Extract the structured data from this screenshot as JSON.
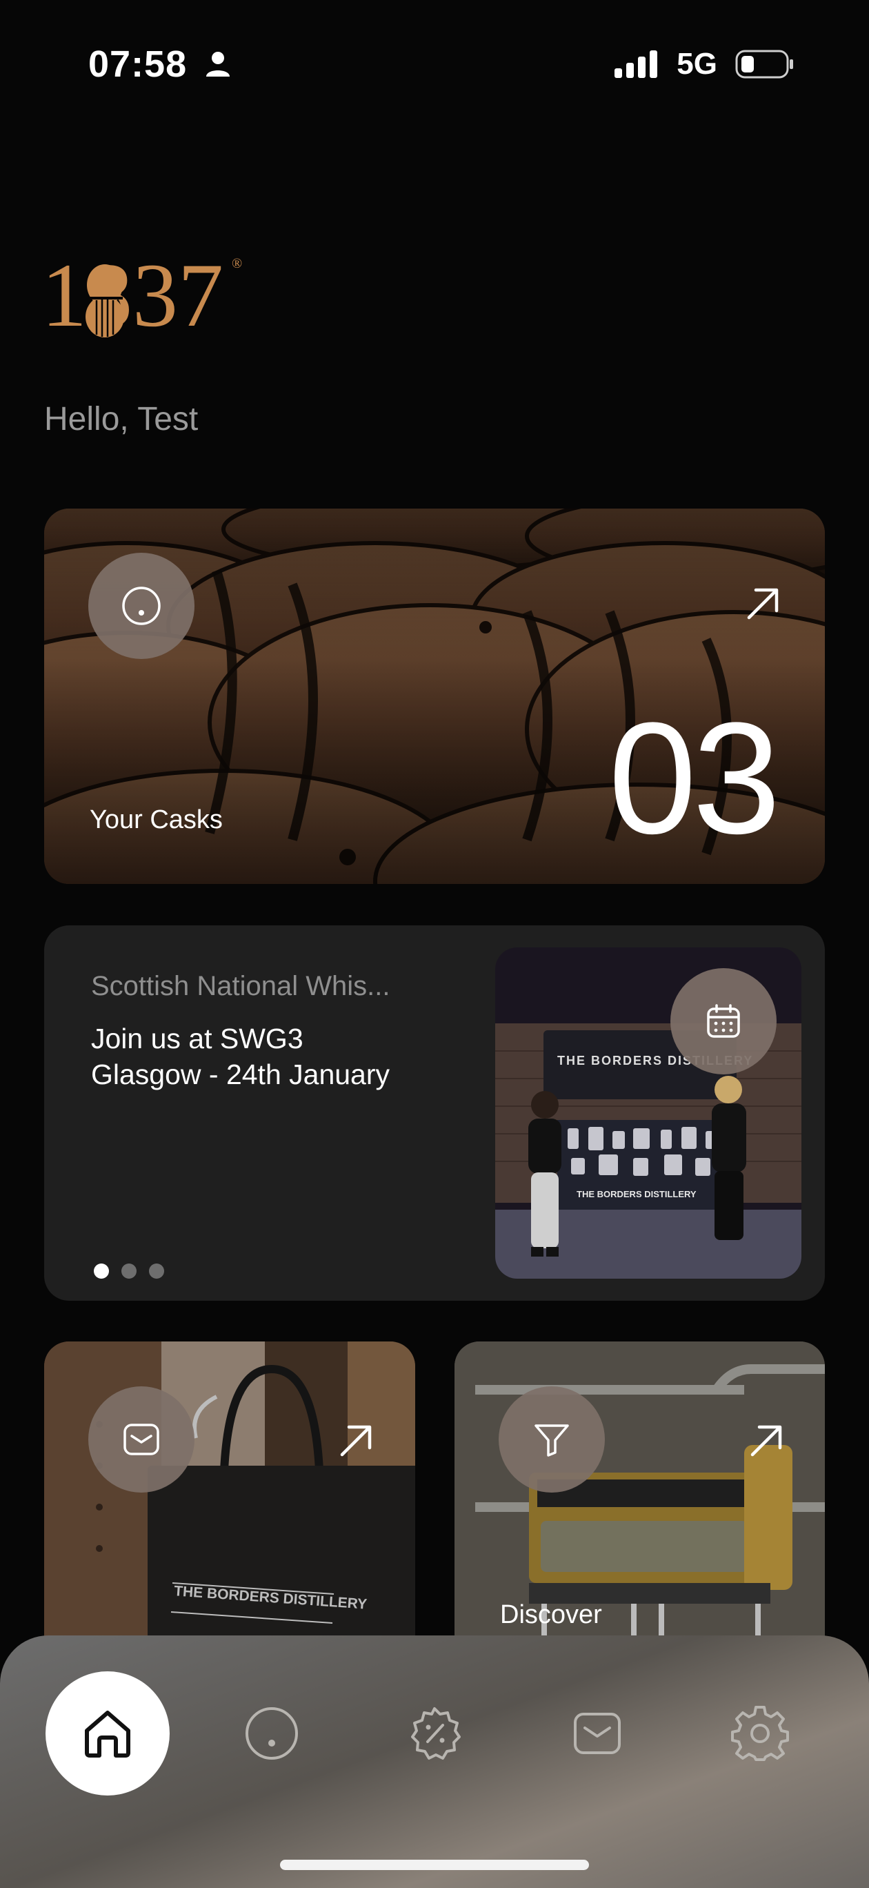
{
  "status_bar": {
    "time": "07:58",
    "network": "5G"
  },
  "brand": {
    "logo_text": "1837",
    "registered_mark": "®",
    "logo_color": "#c88a4e"
  },
  "greeting": "Hello, Test",
  "casks_card": {
    "label": "Your Casks",
    "count": "03"
  },
  "events_card": {
    "category": "Scottish National Whis...",
    "title_line1": "Join us at SWG3",
    "title_line2": "Glasgow - 24th January",
    "banner_text": "THE BORDERS DISTILLERY",
    "stand_text": "THE BORDERS DISTILLERY",
    "pages": 3,
    "active_page": 1
  },
  "shop_card": {
    "bag_text": "THE BORDERS DISTILLERY"
  },
  "discover_card": {
    "label": "Discover"
  },
  "tab_bar": {
    "tabs": [
      {
        "icon": "home-icon",
        "active": true
      },
      {
        "icon": "cask-icon",
        "active": false
      },
      {
        "icon": "offers-icon",
        "active": false
      },
      {
        "icon": "mail-icon",
        "active": false
      },
      {
        "icon": "settings-icon",
        "active": false
      }
    ]
  }
}
